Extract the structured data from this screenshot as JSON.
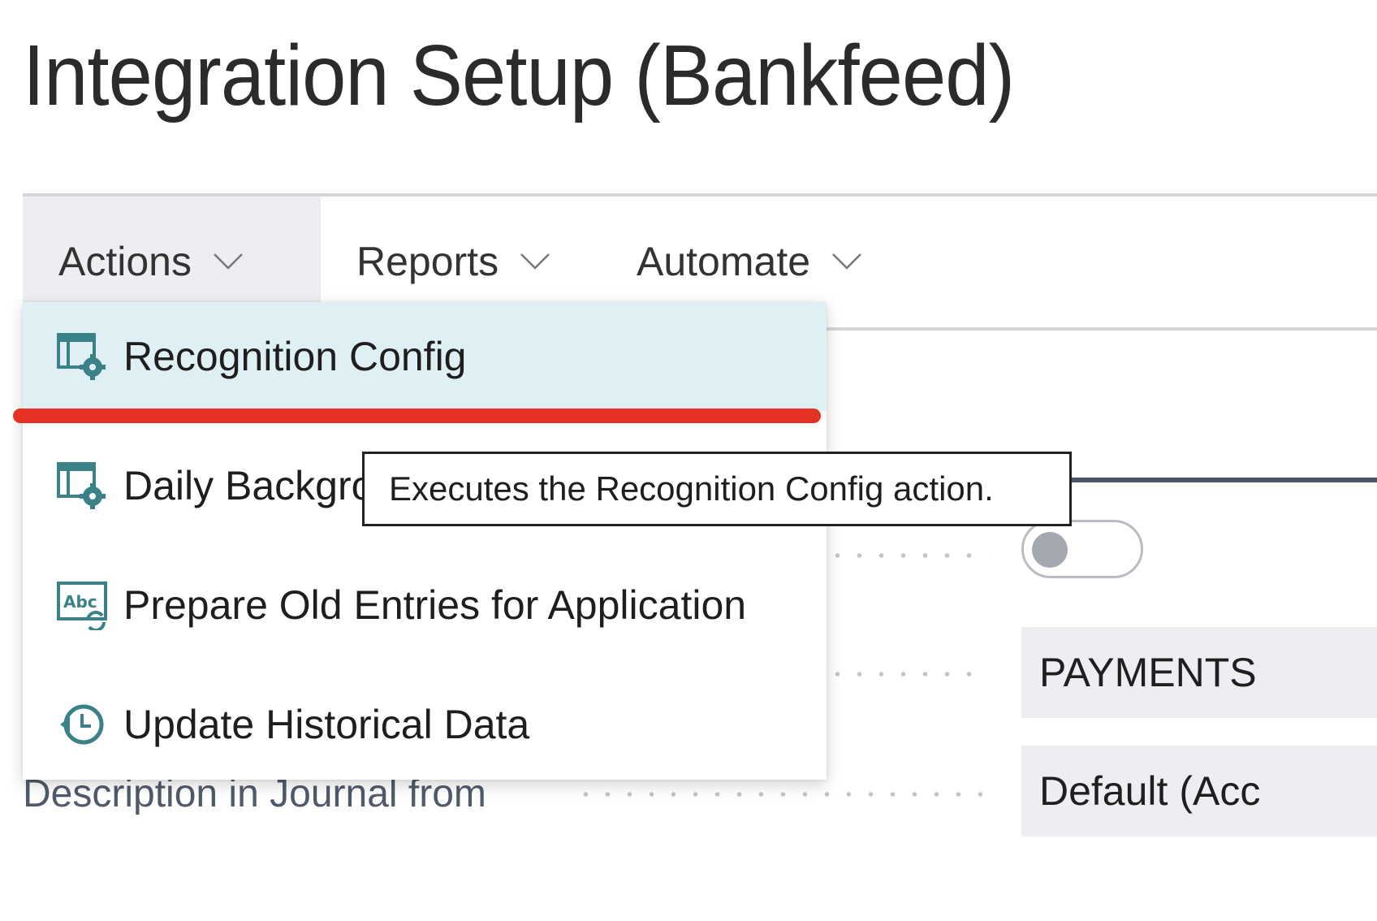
{
  "page": {
    "title": "Integration Setup (Bankfeed)"
  },
  "actionbar": {
    "tabs": [
      {
        "label": "Actions",
        "active": true
      },
      {
        "label": "Reports",
        "active": false
      },
      {
        "label": "Automate",
        "active": false
      }
    ]
  },
  "actions_menu": {
    "items": [
      {
        "label": "Recognition Config",
        "icon": "table-gear-icon",
        "hovered": true
      },
      {
        "label": "Daily Background Job",
        "visible_label": "Daily Backgr",
        "icon": "table-gear-icon",
        "hovered": false
      },
      {
        "label": "Prepare Old Entries for Application",
        "icon": "text-refresh-icon",
        "hovered": false
      },
      {
        "label": "Update Historical Data",
        "icon": "history-clock-icon",
        "hovered": false
      }
    ]
  },
  "tooltip": {
    "text": "Executes the Recognition Config action."
  },
  "form": {
    "toggle_field": {
      "value": false
    },
    "journal_field": {
      "value": "PAYMENTS"
    },
    "description_field": {
      "label": "Description in Journal from",
      "value": "Default (Acc"
    }
  },
  "colors": {
    "accent_teal": "#3a8287",
    "hover_bg": "#dff0f4",
    "highlight_red": "#e63125",
    "tab_active_bg": "#eceef1"
  }
}
